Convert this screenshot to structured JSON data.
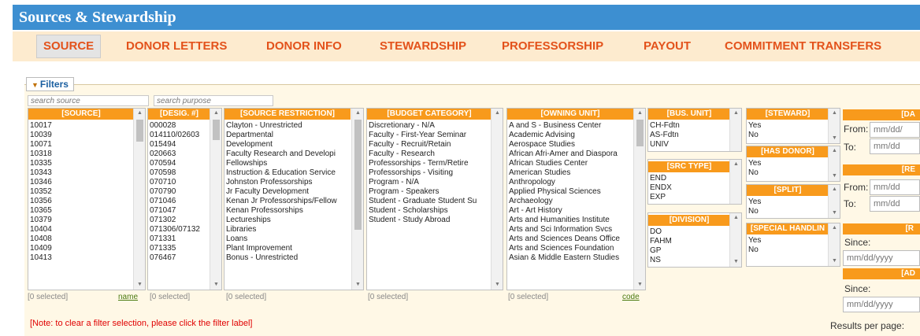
{
  "app": {
    "title": "Sources & Stewardship"
  },
  "tabs": [
    {
      "label": "SOURCE"
    },
    {
      "label": "DONOR LETTERS"
    },
    {
      "label": "DONOR INFO"
    },
    {
      "label": "STEWARDSHIP"
    },
    {
      "label": "PROFESSORSHIP"
    },
    {
      "label": "PAYOUT"
    },
    {
      "label": "COMMITMENT TRANSFERS"
    }
  ],
  "filters": {
    "label": "Filters",
    "search_source_placeholder": "search source",
    "search_purpose_placeholder": "search purpose",
    "source": {
      "header": "[SOURCE]",
      "items": [
        "10017",
        "10039",
        "10071",
        "10318",
        "10335",
        "10343",
        "10346",
        "10352",
        "10356",
        "10365",
        "10379",
        "10404",
        "10408",
        "10409",
        "10413"
      ],
      "selected": "[0 selected]",
      "link": "name"
    },
    "desig": {
      "header": "[DESIG. #]",
      "items": [
        "000028",
        "014110/02603",
        "015494",
        "020663",
        "070594",
        "070598",
        "070710",
        "070790",
        "071046",
        "071047",
        "071302",
        "071306/07132",
        "071331",
        "071335",
        "076467"
      ],
      "selected": "[0 selected]"
    },
    "restriction": {
      "header": "[SOURCE RESTRICTION]",
      "items": [
        "Clayton - Unrestricted",
        "Departmental",
        "Development",
        "Faculty Research and Developi",
        "Fellowships",
        "Instruction & Education Service",
        "Johnston Professorships",
        "Jr Faculty Development",
        "Kenan Jr Professorships/Fellow",
        "Kenan Professorships",
        "Lectureships",
        "Libraries",
        "Loans",
        "Plant Improvement",
        "Bonus - Unrestricted"
      ],
      "selected": "[0 selected]"
    },
    "budget": {
      "header": "[BUDGET CATEGORY]",
      "items": [
        "Discretionary - N/A",
        "Faculty - First-Year Seminar",
        "Faculty - Recruit/Retain",
        "Faculty - Research",
        "Professorships - Term/Retire",
        "Professorships - Visiting",
        "Program - N/A",
        "Program - Speakers",
        "Student - Graduate Student Su",
        "Student - Scholarships",
        "Student - Study Abroad"
      ],
      "selected": "[0 selected]"
    },
    "owning": {
      "header": "[OWNING UNIT]",
      "items": [
        "A and S - Business Center",
        "Academic Advising",
        "Aerospace Studies",
        "African Afri-Amer and Diaspora",
        "African Studies Center",
        "American Studies",
        "Anthropology",
        "Applied Physical Sciences",
        "Archaeology",
        "Art - Art History",
        "Arts and Humanities Institute",
        "Arts and Sci Information Svcs",
        "Arts and Sciences Deans Office",
        "Arts and Sciences Foundation",
        "Asian & Middle Eastern Studies"
      ],
      "selected": "[0 selected]",
      "link": "code"
    },
    "bus_unit": {
      "header": "[BUS. UNIT]",
      "items": [
        "CH-Fdtn",
        "AS-Fdtn",
        "UNIV"
      ]
    },
    "src_type": {
      "header": "[SRC TYPE]",
      "items": [
        "END",
        "ENDX",
        "EXP"
      ]
    },
    "division": {
      "header": "[DIVISION]",
      "items": [
        "DO",
        "FAHM",
        "GP",
        "NS"
      ]
    },
    "steward": {
      "header": "[STEWARD]",
      "items": [
        "Yes",
        "No"
      ]
    },
    "has_donor": {
      "header": "[HAS DONOR]",
      "items": [
        "Yes",
        "No"
      ]
    },
    "split": {
      "header": "[SPLIT]",
      "items": [
        "Yes",
        "No"
      ]
    },
    "special": {
      "header": "[SPECIAL HANDLIN",
      "items": [
        "Yes",
        "No"
      ]
    },
    "right": {
      "hdr1": "[DA",
      "from": "From:",
      "to": "To:",
      "date_placeholder": "mm/dd/",
      "date_placeholder2": "mm/dd",
      "hdr2": "[RE",
      "from2_placeholder": "mm/dd",
      "to2_placeholder": "mm/dd",
      "hdr3": "[R",
      "since": "Since:",
      "since_placeholder": "mm/dd/yyyy",
      "hdr4": "[AD",
      "since2": "Since:",
      "since2_placeholder": "mm/dd/yyyy",
      "results": "Results per page:"
    },
    "note": "[Note: to clear a filter selection, please click the filter label]"
  }
}
